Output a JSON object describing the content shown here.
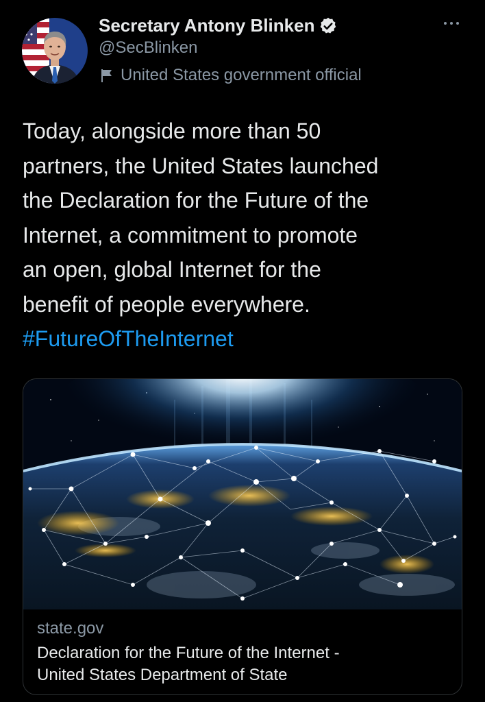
{
  "author": {
    "display_name": "Secretary Antony Blinken",
    "handle": "@SecBlinken",
    "label": "United States government official",
    "verified_icon": "verified-badge-icon",
    "label_icon": "flag-icon",
    "more_icon": "more-options-icon"
  },
  "tweet": {
    "lines": [
      "Today, alongside more than 50",
      "partners, the United States launched",
      "the Declaration for the Future of the",
      "Internet, a commitment to promote",
      "an open, global Internet for the",
      "benefit of people everywhere."
    ],
    "hashtag": "#FutureOfTheInternet"
  },
  "card": {
    "domain": "state.gov",
    "title_lines": [
      "Declaration for the Future of the Internet -",
      "United States Department of State"
    ]
  },
  "colors": {
    "background": "#000000",
    "text": "#e7e9ea",
    "secondary": "#8b98a5",
    "link": "#1d9bf0",
    "border": "#2f3336"
  }
}
